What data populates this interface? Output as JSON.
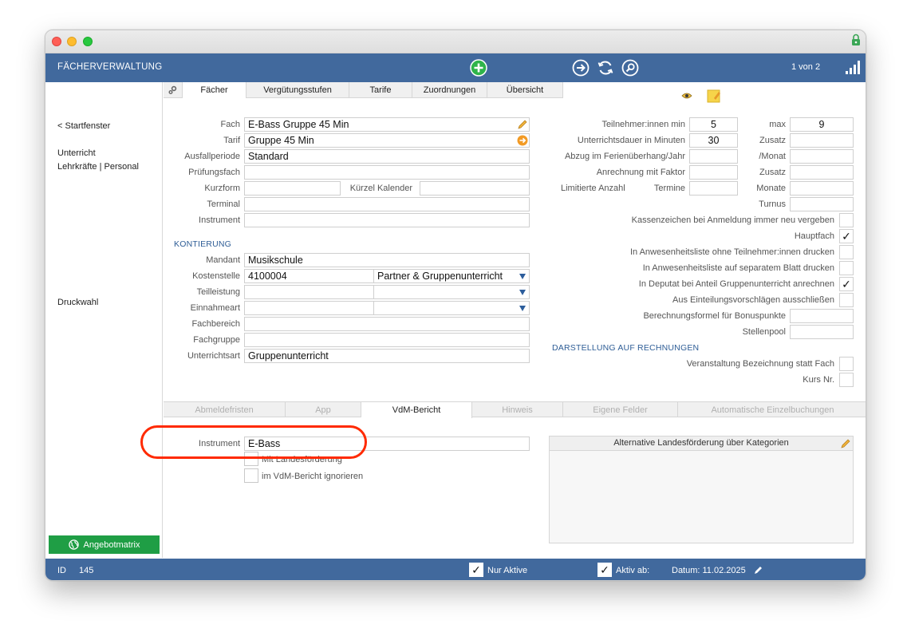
{
  "header": {
    "title": "FÄCHERVERWALTUNG",
    "pager": "1 von 2"
  },
  "sidebar": {
    "back": "< Startfenster",
    "unterricht": "Unterricht",
    "lehrkraefte": "Lehrkräfte | Personal",
    "druckwahl": "Druckwahl",
    "angebot": "Angebotmatrix"
  },
  "tabs": [
    {
      "label": "Fächer",
      "active": true
    },
    {
      "label": "Vergütungsstufen",
      "active": false
    },
    {
      "label": "Tarife",
      "active": false
    },
    {
      "label": "Zuordnungen",
      "active": false
    },
    {
      "label": "Übersicht",
      "active": false
    }
  ],
  "left_form": {
    "fach_label": "Fach",
    "fach_value": "E-Bass Gruppe 45 Min",
    "tarif_label": "Tarif",
    "tarif_value": "Gruppe 45 Min",
    "ausfall_label": "Ausfallperiode",
    "ausfall_value": "Standard",
    "pruef_label": "Prüfungsfach",
    "pruef_value": "",
    "kurzform_label": "Kurzform",
    "kurzform_value": "",
    "kuerzel_label": "Kürzel Kalender",
    "kuerzel_value": "",
    "terminal_label": "Terminal",
    "terminal_value": "",
    "instrument_label": "Instrument",
    "instrument_value": ""
  },
  "kontierung": {
    "heading": "KONTIERUNG",
    "mandant_label": "Mandant",
    "mandant_value": "Musikschule",
    "kosten_label": "Kostenstelle",
    "kosten_value": "4100004",
    "kosten_select": "Partner & Gruppenunterricht",
    "teil_label": "Teilleistung",
    "teil_value": "",
    "teil_select": "",
    "einnahme_label": "Einnahmeart",
    "einnahme_value": "",
    "einnahme_select": "",
    "fachbereich_label": "Fachbereich",
    "fachbereich_value": "",
    "fachgruppe_label": "Fachgruppe",
    "fachgruppe_value": "",
    "uart_label": "Unterrichtsart",
    "uart_value": "Gruppenunterricht"
  },
  "right_form": {
    "tn_label": "Teilnehmer:innen min",
    "tn_value": "5",
    "max_label": "max",
    "max_value": "9",
    "dauer_label": "Unterrichtsdauer in Minuten",
    "dauer_value": "30",
    "zusatz1_label": "Zusatz",
    "zusatz1_value": "",
    "abzug_label": "Abzug im Ferienüberhang/Jahr",
    "abzug_value": "",
    "monat_label": "/Monat",
    "monat_value": "",
    "anrech_label": "Anrechnung mit Faktor",
    "anrech_value": "",
    "zusatz2_label": "Zusatz",
    "zusatz2_value": "",
    "limit_label": "Limitierte Anzahl",
    "termine_label": "Termine",
    "termine_value": "",
    "monate_label": "Monate",
    "monate_value": "",
    "turnus_label": "Turnus",
    "turnus_value": "",
    "kassen_label": "Kassenzeichen bei Anmeldung immer neu vergeben",
    "kassen_checked": "",
    "haupt_label": "Hauptfach",
    "haupt_checked": "✓",
    "anw1_label": "In Anwesenheitsliste ohne Teilnehmer:innen drucken",
    "anw1_checked": "",
    "anw2_label": "In Anwesenheitsliste auf separatem Blatt drucken",
    "anw2_checked": "",
    "deputat_label": "In Deputat bei Anteil Gruppenunterricht anrechnen",
    "deputat_checked": "✓",
    "einteil_label": "Aus Einteilungsvorschlägen ausschließen",
    "einteil_checked": "",
    "bonus_label": "Berechnungsformel für Bonuspunkte",
    "bonus_value": "",
    "stellen_label": "Stellenpool",
    "stellen_value": "",
    "darst_heading": "DARSTELLUNG AUF RECHNUNGEN",
    "veran_label": "Veranstaltung Bezeichnung statt Fach",
    "veran_checked": "",
    "kurs_label": "Kurs Nr.",
    "kurs_checked": ""
  },
  "bottom_tabs": [
    {
      "label": "Abmeldefristen",
      "state": "disabled"
    },
    {
      "label": "App",
      "state": "disabled"
    },
    {
      "label": "VdM-Bericht",
      "state": "active"
    },
    {
      "label": "Hinweis",
      "state": "disabled"
    },
    {
      "label": "Eigene Felder",
      "state": "disabled"
    },
    {
      "label": "Automatische Einzelbuchungen",
      "state": "disabled"
    }
  ],
  "vdm": {
    "instrument_label": "Instrument",
    "instrument_value": "E-Bass",
    "landes_label": "Mit Landesförderung",
    "ignore_label": "im VdM-Bericht ignorieren",
    "panel_title": "Alternative Landesförderung über Kategorien"
  },
  "footer": {
    "id_label": "ID",
    "id_value": "145",
    "nur_aktive": "Nur Aktive",
    "nur_aktive_checked": "✓",
    "aktiv_ab": "Aktiv ab:",
    "aktiv_ab_checked": "✓",
    "datum": "Datum: 11.02.2025"
  },
  "colors": {
    "header": "#41699d",
    "accent_blue": "#2e5d96",
    "green": "#1f9e45",
    "highlight": "#ff2a00"
  }
}
